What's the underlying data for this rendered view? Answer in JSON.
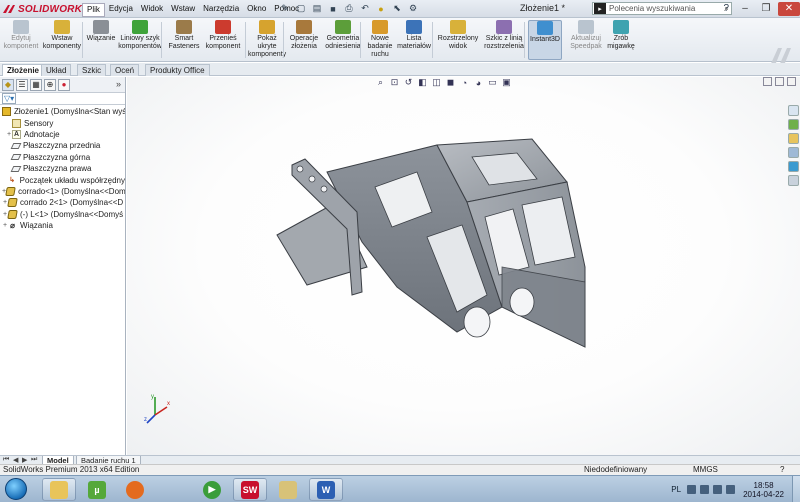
{
  "titlebar": {
    "app_name": "SOLIDWORKS",
    "menu": [
      "Plik",
      "Edycja",
      "Widok",
      "Wstaw",
      "Narzędzia",
      "Okno",
      "Pomoc"
    ],
    "document_title": "Złożenie1 *",
    "search_placeholder": "Polecenia wyszukiwania",
    "help_icon": "?",
    "quick_icons": [
      "pin-icon",
      "new-document-icon",
      "open-icon",
      "save-icon",
      "print-icon",
      "undo-icon",
      "rebuild-icon",
      "select-icon",
      "options-icon"
    ]
  },
  "ribbon": {
    "buttons": [
      {
        "id": "edit-component",
        "label": "Edytuj\nkomponent",
        "color": "#b9c4cf",
        "dim": true
      },
      {
        "id": "insert-components",
        "label": "Wstaw\nkomponenty",
        "color": "#d8b13a"
      },
      {
        "id": "mate",
        "label": "Wiązanie",
        "color": "#8a8f96"
      },
      {
        "id": "linear-pattern",
        "label": "Liniowy szyk\nkomponentów",
        "color": "#3fa33a"
      },
      {
        "id": "smart-fasteners",
        "label": "Smart\nFasteners",
        "color": "#9b7b4a"
      },
      {
        "id": "move-component",
        "label": "Przenieś\nkomponent",
        "color": "#cc3b2e"
      },
      {
        "id": "show-hidden",
        "label": "Pokaż\nukryte\nkomponenty",
        "color": "#d6a32e"
      },
      {
        "id": "assembly-features",
        "label": "Operacje\nzłożenia",
        "color": "#a8793c"
      },
      {
        "id": "reference-geometry",
        "label": "Geometria\nodniesienia",
        "color": "#5c9e3a"
      },
      {
        "id": "new-motion-study",
        "label": "Nowe\nbadanie\nruchu",
        "color": "#d89a2b"
      },
      {
        "id": "bill-of-materials",
        "label": "Lista\nmateriałów",
        "color": "#3c73b8"
      },
      {
        "id": "exploded-view",
        "label": "Rozstrzelony\nwidok",
        "color": "#d8b13a"
      },
      {
        "id": "explode-line-sketch",
        "label": "Szkic z linią\nrozstrzelenia",
        "color": "#8c6fb0"
      },
      {
        "id": "instant3d",
        "label": "Instant3D",
        "color": "#3f8fcf",
        "active": true
      },
      {
        "id": "update-speedpak",
        "label": "Aktualizuj\nSpeedpak",
        "color": "#b9c4cf",
        "dim": true
      },
      {
        "id": "take-snapshot",
        "label": "Zrób\nmigawkę",
        "color": "#3fa3b0"
      }
    ]
  },
  "tabs": [
    "Złożenie",
    "Układ",
    "Szkic",
    "Oceń",
    "Produkty Office"
  ],
  "tree": {
    "nodes": [
      {
        "label": "Złożenie1  (Domyślna<Stan wyświ",
        "icon": "asm",
        "expand": "",
        "indent": 0
      },
      {
        "label": "Sensory",
        "icon": "sensor",
        "expand": "",
        "indent": 1
      },
      {
        "label": "Adnotacje",
        "icon": "note",
        "expand": "+",
        "indent": 1
      },
      {
        "label": "Płaszczyzna przednia",
        "icon": "plane",
        "expand": "",
        "indent": 1
      },
      {
        "label": "Płaszczyzna górna",
        "icon": "plane",
        "expand": "",
        "indent": 1
      },
      {
        "label": "Płaszczyzna prawa",
        "icon": "plane",
        "expand": "",
        "indent": 1
      },
      {
        "label": "Początek układu współrzędny",
        "icon": "origin",
        "expand": "",
        "indent": 1
      },
      {
        "label": "corrado<1> (Domyślna<<Dom",
        "icon": "part",
        "expand": "+",
        "indent": 0
      },
      {
        "label": "corrado 2<1> (Domyślna<<D",
        "icon": "part",
        "expand": "+",
        "indent": 0
      },
      {
        "label": "(-) L<1> (Domyślna<<Domyś",
        "icon": "part",
        "expand": "+",
        "indent": 0
      },
      {
        "label": "Wiązania",
        "icon": "mate",
        "expand": "+",
        "indent": 0
      }
    ]
  },
  "viewport": {
    "triad_labels": {
      "x": "x",
      "y": "y",
      "z": "z"
    }
  },
  "model_tabs": [
    "Model",
    "Badanie ruchu 1"
  ],
  "status": {
    "edition": "SolidWorks Premium 2013 x64 Edition",
    "state": "Niedodefiniowany",
    "units": "MMGS"
  },
  "taskbar": {
    "apps": [
      {
        "id": "explorer",
        "color": "#e8c45a",
        "glyph": "",
        "open": true
      },
      {
        "id": "utorrent",
        "color": "#55a83a",
        "glyph": "µ",
        "open": false
      },
      {
        "id": "firefox",
        "color": "#e46b1f",
        "glyph": "",
        "open": false
      },
      {
        "id": "media-player",
        "color": "#3a9d3a",
        "glyph": "▶",
        "open": false
      },
      {
        "id": "solidworks",
        "color": "#c8102e",
        "glyph": "SW",
        "open": true
      },
      {
        "id": "folder",
        "color": "#d8c278",
        "glyph": "",
        "open": false
      },
      {
        "id": "word",
        "color": "#2b5fb3",
        "glyph": "W",
        "open": true
      }
    ],
    "language": "PL",
    "time": "18:58",
    "date": "2014-04-22"
  }
}
